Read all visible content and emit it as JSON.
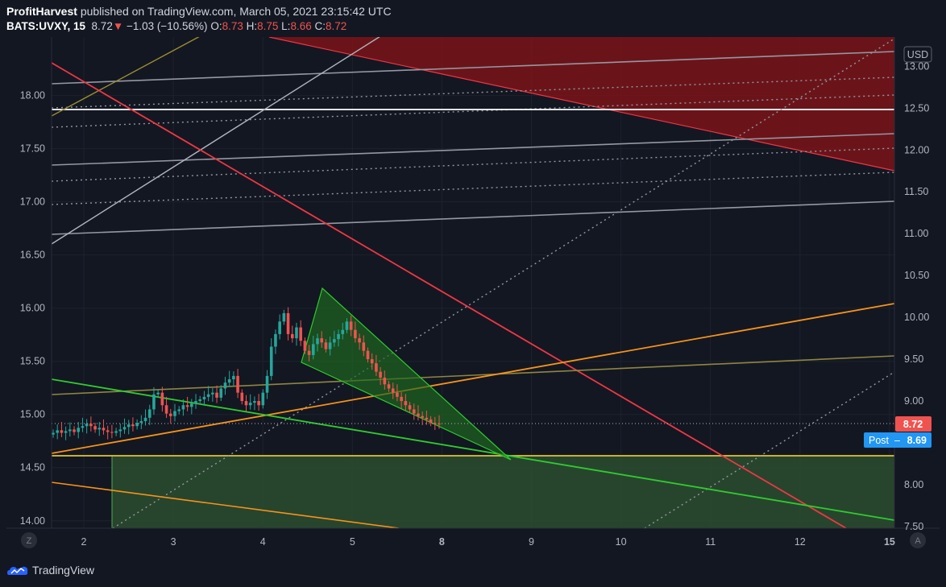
{
  "header": {
    "author": "ProfitHarvest",
    "published_text": "published on TradingView.com, March 05, 2021 23:15:42 UTC",
    "symbol": "BATS:UVXY, 15",
    "last": "8.72",
    "change": "−1.03 (−10.56%)",
    "open_label": "O:",
    "open": "8.73",
    "high_label": "H:",
    "high": "8.75",
    "low_label": "L:",
    "low": "8.66",
    "close_label": "C:",
    "close": "8.72"
  },
  "footer": {
    "brand": "TradingView"
  },
  "chart_data": {
    "type": "candlestick",
    "currency_label": "USD",
    "x_ticks": [
      "2",
      "3",
      "4",
      "5",
      "8",
      "9",
      "10",
      "11",
      "12",
      "15"
    ],
    "left_axis": {
      "ticks": [
        "14.00",
        "14.50",
        "15.00",
        "15.50",
        "16.00",
        "16.50",
        "17.00",
        "17.50",
        "18.00"
      ],
      "range": [
        13.93,
        18.55
      ]
    },
    "right_axis": {
      "ticks": [
        "7.50",
        "8.00",
        "8.50",
        "9.00",
        "9.50",
        "10.00",
        "10.50",
        "11.00",
        "11.50",
        "12.00",
        "12.50",
        "13.00"
      ],
      "range": [
        7.48,
        13.35
      ]
    },
    "last_price": "8.72",
    "post_label": "Post",
    "post_price": "8.69",
    "corner_left": "Z",
    "corner_right": "A",
    "colors": {
      "up": "#26a69a",
      "down": "#ef5350",
      "background": "#131722",
      "post": "#2196f3"
    },
    "candles_close": [
      8.62,
      8.65,
      8.62,
      8.64,
      8.66,
      8.63,
      8.68,
      8.7,
      8.73,
      8.7,
      8.66,
      8.68,
      8.65,
      8.63,
      8.62,
      8.64,
      8.66,
      8.69,
      8.72,
      8.7,
      8.74,
      8.76,
      8.8,
      8.9,
      9.08,
      9.1,
      8.95,
      8.85,
      8.82,
      8.88,
      8.9,
      8.95,
      8.93,
      8.97,
      9.0,
      9.02,
      9.05,
      9.08,
      9.1,
      9.04,
      9.15,
      9.22,
      9.26,
      9.3,
      9.1,
      9.0,
      8.95,
      8.98,
      9.0,
      8.95,
      9.1,
      9.3,
      9.65,
      9.8,
      9.95,
      10.05,
      9.8,
      9.75,
      9.88,
      9.72,
      9.6,
      9.55,
      9.68,
      9.75,
      9.7,
      9.62,
      9.7,
      9.74,
      9.8,
      9.85,
      9.95,
      9.85,
      9.75,
      9.7,
      9.6,
      9.5,
      9.45,
      9.35,
      9.28,
      9.2,
      9.15,
      9.1,
      9.05,
      9.0,
      8.95,
      8.9,
      8.85,
      8.82,
      8.8,
      8.78,
      8.74,
      8.73,
      8.72
    ]
  }
}
